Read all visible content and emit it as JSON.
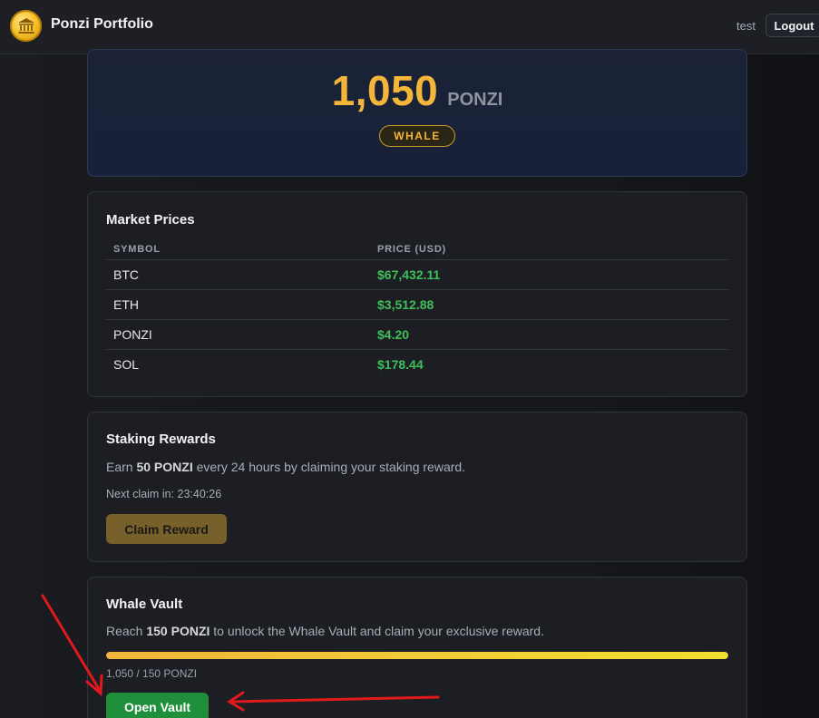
{
  "header": {
    "app_title": "Ponzi Portfolio",
    "username": "test",
    "logout_label": "Logout"
  },
  "hero": {
    "balance": "1,050",
    "unit": "PONZI",
    "tier": "WHALE"
  },
  "market": {
    "title": "Market Prices",
    "columns": [
      "SYMBOL",
      "PRICE (USD)"
    ],
    "rows": [
      {
        "symbol": "BTC",
        "price": "$67,432.11"
      },
      {
        "symbol": "ETH",
        "price": "$3,512.88"
      },
      {
        "symbol": "PONZI",
        "price": "$4.20"
      },
      {
        "symbol": "SOL",
        "price": "$178.44"
      }
    ]
  },
  "staking": {
    "title": "Staking Rewards",
    "desc_prefix": "Earn ",
    "desc_amount": "50 PONZI",
    "desc_suffix": " every 24 hours by claiming your staking reward.",
    "next_claim": "Next claim in: 23:40:26",
    "claim_label": "Claim Reward"
  },
  "vault": {
    "title": "Whale Vault",
    "desc_prefix": "Reach ",
    "desc_amount": "150 PONZI",
    "desc_suffix": " to unlock the Whale Vault and claim your exclusive reward.",
    "progress_fraction": 1.0,
    "progress_text": "1,050 / 150 PONZI",
    "open_label": "Open Vault"
  },
  "colors": {
    "accent_gold": "#f4b63a",
    "price_green": "#3fbf5a",
    "open_button": "#1f8f3c",
    "annotation_red": "#e0191b"
  },
  "icons": {
    "logo": "bank-coin-icon",
    "annotation": "arrow-icon"
  }
}
